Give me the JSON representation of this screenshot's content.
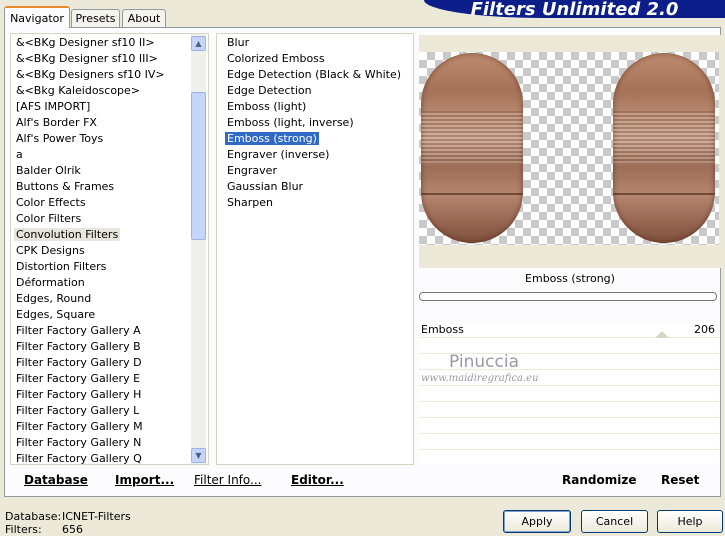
{
  "tabs": [
    {
      "label": "Navigator"
    },
    {
      "label": "Presets"
    },
    {
      "label": "About"
    }
  ],
  "banner": {
    "title": "Filters Unlimited 2.0"
  },
  "categories": [
    "&<BKg Designer sf10 II>",
    "&<BKg Designer sf10 III>",
    "&<BKg Designers sf10 IV>",
    "&<Bkg Kaleidoscope>",
    "[AFS IMPORT]",
    "Alf's Border FX",
    "Alf's Power Toys",
    "a",
    "Balder Olrik",
    "Buttons & Frames",
    "Color Effects",
    "Color Filters",
    "Convolution Filters",
    "CPK Designs",
    "Distortion Filters",
    "Déformation",
    "Edges, Round",
    "Edges, Square",
    "Filter Factory Gallery A",
    "Filter Factory Gallery B",
    "Filter Factory Gallery D",
    "Filter Factory Gallery E",
    "Filter Factory Gallery H",
    "Filter Factory Gallery L",
    "Filter Factory Gallery M",
    "Filter Factory Gallery N",
    "Filter Factory Gallery Q"
  ],
  "selected_category": "Convolution Filters",
  "filters": [
    "Blur",
    "Colorized Emboss",
    "Edge Detection (Black & White)",
    "Edge Detection",
    "Emboss (light)",
    "Emboss (light, inverse)",
    "Emboss (strong)",
    "Engraver (inverse)",
    "Engraver",
    "Gaussian Blur",
    "Sharpen"
  ],
  "selected_filter": "Emboss (strong)",
  "preview": {
    "filter_name": "Emboss (strong)"
  },
  "slider": {
    "label": "Emboss",
    "value": "206",
    "fraction": 0.81
  },
  "watermark": {
    "name": "Pinuccia",
    "url": "www.maidiregrafica.eu"
  },
  "panel_buttons": {
    "database": "Database",
    "import": "Import...",
    "filter_info": "Filter Info...",
    "editor": "Editor...",
    "randomize": "Randomize",
    "reset": "Reset"
  },
  "status": {
    "database_label": "Database:",
    "database_value": "ICNET-Filters",
    "filters_label": "Filters:",
    "filters_value": "656"
  },
  "dialog_buttons": {
    "apply": "Apply",
    "cancel": "Cancel",
    "help": "Help"
  }
}
